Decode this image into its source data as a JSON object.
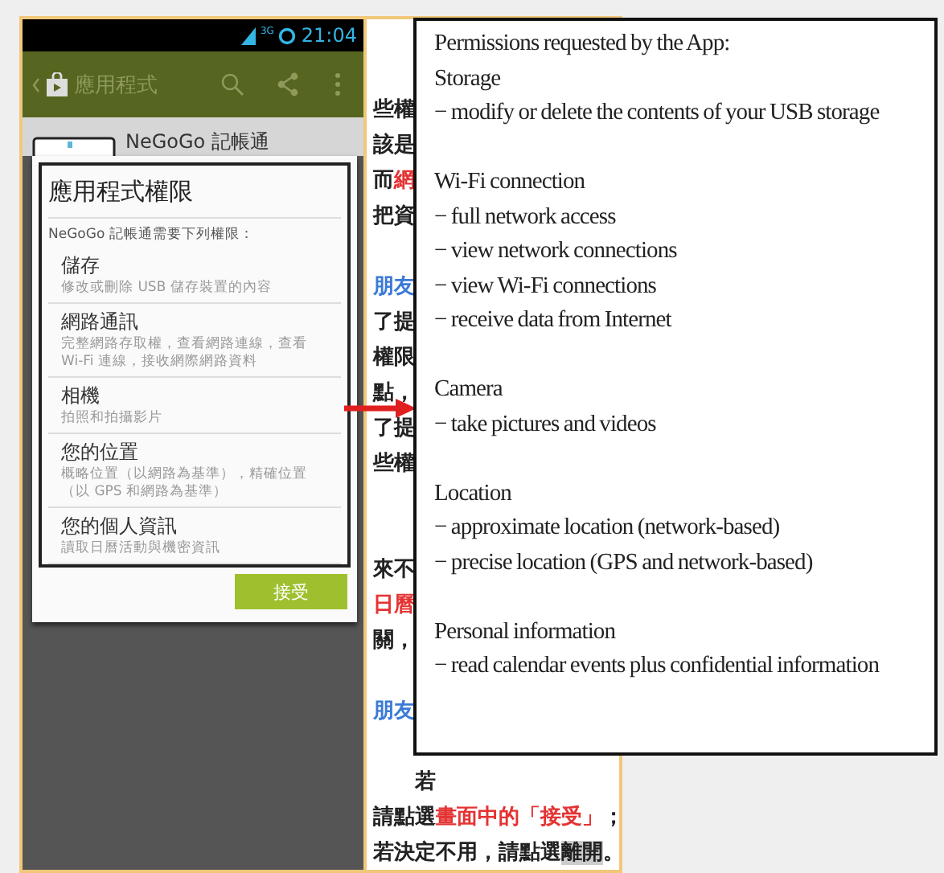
{
  "phone": {
    "status_bar": {
      "network": "3G",
      "time": "21:04"
    },
    "action_bar": {
      "title": "應用程式"
    },
    "app_header": {
      "name": "NeGoGo 記帳通"
    },
    "dialog": {
      "title": "應用程式權限",
      "intro": "NeGoGo 記帳通需要下列權限：",
      "permissions": [
        {
          "name": "儲存",
          "detail": "修改或刪除 USB 儲存裝置的內容"
        },
        {
          "name": "網路通訊",
          "detail": "完整網路存取權，查看網路連線，查看 Wi-Fi 連線，接收網際網路資料"
        },
        {
          "name": "相機",
          "detail": "拍照和拍攝影片"
        },
        {
          "name": "您的位置",
          "detail": "概略位置（以網路為基準），精確位置（以 GPS 和網路為基準）"
        },
        {
          "name": "您的個人資訊",
          "detail": "讀取日曆活動與機密資訊"
        }
      ],
      "accept_button": "接受"
    }
  },
  "article": {
    "lines": [
      {
        "kind": "blank"
      },
      {
        "kind": "text",
        "segments": [
          {
            "text": "些權",
            "kind": "normal"
          }
        ]
      },
      {
        "kind": "text",
        "segments": [
          {
            "text": "該是",
            "kind": "normal"
          }
        ]
      },
      {
        "kind": "text",
        "segments": [
          {
            "text": "而",
            "kind": "normal"
          },
          {
            "text": "網",
            "kind": "red"
          }
        ]
      },
      {
        "kind": "text",
        "segments": [
          {
            "text": "把資",
            "kind": "normal"
          }
        ]
      },
      {
        "kind": "blank"
      },
      {
        "kind": "text",
        "segments": [
          {
            "text": "朋友",
            "kind": "blue"
          }
        ]
      },
      {
        "kind": "text",
        "segments": [
          {
            "text": "了提",
            "kind": "normal"
          }
        ]
      },
      {
        "kind": "text",
        "segments": [
          {
            "text": "權限",
            "kind": "normal"
          }
        ]
      },
      {
        "kind": "text",
        "segments": [
          {
            "text": "點，",
            "kind": "normal"
          }
        ]
      },
      {
        "kind": "text",
        "segments": [
          {
            "text": "了提",
            "kind": "normal"
          }
        ]
      },
      {
        "kind": "text",
        "segments": [
          {
            "text": "些權",
            "kind": "normal"
          }
        ]
      },
      {
        "kind": "blank"
      },
      {
        "kind": "blank"
      },
      {
        "kind": "text",
        "segments": [
          {
            "text": "來不",
            "kind": "normal"
          }
        ]
      },
      {
        "kind": "text",
        "segments": [
          {
            "text": "日曆",
            "kind": "red"
          }
        ]
      },
      {
        "kind": "text",
        "segments": [
          {
            "text": "關，",
            "kind": "normal"
          }
        ]
      },
      {
        "kind": "blank"
      },
      {
        "kind": "text",
        "segments": [
          {
            "text": "朋友",
            "kind": "blue"
          }
        ]
      },
      {
        "kind": "blank"
      },
      {
        "kind": "indented",
        "segments": [
          {
            "text": "若",
            "kind": "normal"
          }
        ]
      },
      {
        "kind": "text",
        "segments": [
          {
            "text": "請點選",
            "kind": "normal"
          },
          {
            "text": "畫面中的「接受」",
            "kind": "red"
          },
          {
            "text": "；",
            "kind": "normal"
          }
        ]
      },
      {
        "kind": "text",
        "segments": [
          {
            "text": "若決定不用，請點選",
            "kind": "normal"
          },
          {
            "text": "離開",
            "kind": "highlight"
          },
          {
            "text": "。",
            "kind": "normal"
          }
        ]
      }
    ]
  },
  "callout": {
    "title": "Permissions requested by the App:",
    "groups": [
      {
        "name": "Storage",
        "items": [
          "− modify or delete the contents of your USB storage"
        ]
      },
      {
        "name": "Wi-Fi connection",
        "items": [
          "− full network access",
          "− view network connections",
          "− view Wi-Fi connections",
          "− receive data from Internet"
        ]
      },
      {
        "name": "Camera",
        "items": [
          "− take pictures and videos"
        ]
      },
      {
        "name": "Location",
        "items": [
          "− approximate location (network-based)",
          "− precise location (GPS and network-based)"
        ]
      },
      {
        "name": "Personal information",
        "items": [
          "− read calendar events plus confidential information"
        ]
      }
    ]
  }
}
